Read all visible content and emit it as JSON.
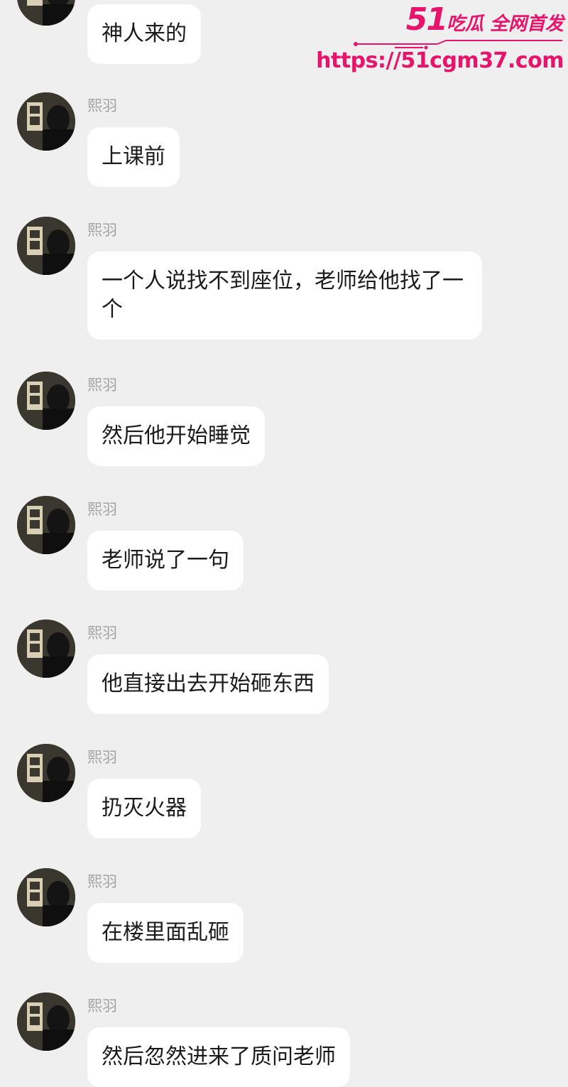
{
  "watermark": {
    "brand_number": "51",
    "brand_slogan": "吃瓜 全网首发",
    "url": "https://51cgm37.com",
    "color": "#e8136b"
  },
  "chat": {
    "messages": [
      {
        "sender": "",
        "text": "神人来的"
      },
      {
        "sender": "熙羽",
        "text": "上课前"
      },
      {
        "sender": "熙羽",
        "text": "一个人说找不到座位，老师给他找了一个"
      },
      {
        "sender": "熙羽",
        "text": "然后他开始睡觉"
      },
      {
        "sender": "熙羽",
        "text": "老师说了一句"
      },
      {
        "sender": "熙羽",
        "text": "他直接出去开始砸东西"
      },
      {
        "sender": "熙羽",
        "text": "扔灭火器"
      },
      {
        "sender": "熙羽",
        "text": "在楼里面乱砸"
      },
      {
        "sender": "熙羽",
        "text": "然后忽然进来了质问老师"
      }
    ]
  },
  "colors": {
    "background": "#efefef",
    "bubble": "#ffffff",
    "sender_name": "#a3a3a3",
    "text": "#1b1b1b"
  }
}
